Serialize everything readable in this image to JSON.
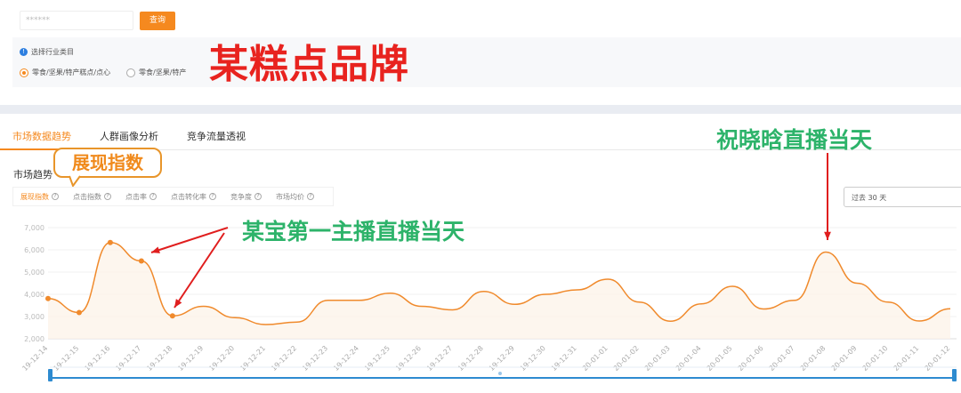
{
  "search": {
    "value": "******",
    "button": "查询"
  },
  "category": {
    "label": "选择行业类目",
    "options": [
      {
        "label": "零食/坚果/特产糕点/点心",
        "selected": true
      },
      {
        "label": "零食/坚果/特产",
        "selected": false
      }
    ]
  },
  "annotations": {
    "brand": "某糕点品牌",
    "callout": "展现指数",
    "event1": "某宝第一主播直播当天",
    "event2": "祝晓晗直播当天"
  },
  "tabs": [
    {
      "label": "市场数据趋势",
      "active": true
    },
    {
      "label": "人群画像分析"
    },
    {
      "label": "竞争流量透视"
    }
  ],
  "section_title": "市场趋势",
  "metrics": [
    {
      "label": "展现指数",
      "active": true
    },
    {
      "label": "点击指数"
    },
    {
      "label": "点击率"
    },
    {
      "label": "点击转化率"
    },
    {
      "label": "竞争度"
    },
    {
      "label": "市场均价"
    }
  ],
  "range_select": "过去 30 天",
  "colors": {
    "accent": "#f5891f",
    "annotation_red": "#e8231f",
    "annotation_green": "#2db36a",
    "slider": "#2e8bd0"
  },
  "chart_data": {
    "type": "area",
    "title": "展现指数",
    "x": [
      "19-12-14",
      "19-12-15",
      "19-12-16",
      "19-12-17",
      "19-12-18",
      "19-12-19",
      "19-12-20",
      "19-12-21",
      "19-12-22",
      "19-12-23",
      "19-12-24",
      "19-12-25",
      "19-12-26",
      "19-12-27",
      "19-12-28",
      "19-12-29",
      "19-12-30",
      "19-12-31",
      "20-01-01",
      "20-01-02",
      "20-01-03",
      "20-01-04",
      "20-01-05",
      "20-01-06",
      "20-01-07",
      "20-01-08",
      "20-01-09",
      "20-01-10",
      "20-01-11",
      "20-01-12"
    ],
    "values": [
      3810,
      3180,
      6330,
      5500,
      3030,
      3460,
      2950,
      2640,
      2750,
      3730,
      3730,
      4050,
      3460,
      3300,
      4130,
      3550,
      4000,
      4200,
      4680,
      3650,
      2790,
      3570,
      4360,
      3340,
      3730,
      5900,
      4500,
      3650,
      2800,
      3350
    ],
    "markers": [
      0,
      1,
      2,
      3,
      4
    ],
    "yticks": [
      "2,000",
      "3,000",
      "4,000",
      "5,000",
      "6,000",
      "7,000"
    ],
    "ylim": [
      2000,
      7000
    ]
  }
}
